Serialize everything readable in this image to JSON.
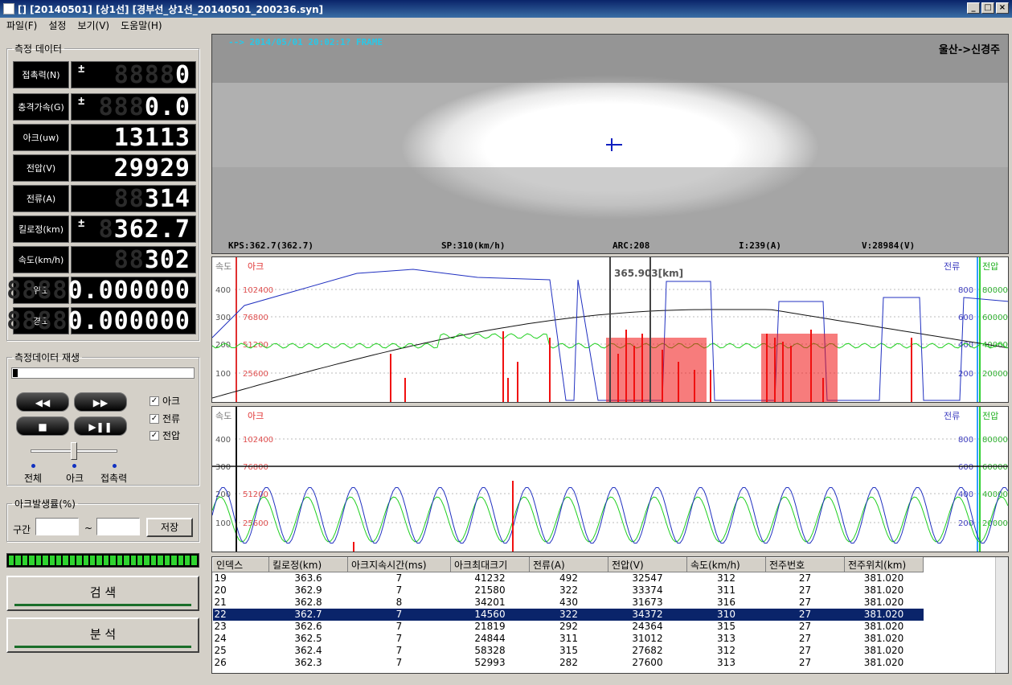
{
  "window": {
    "title": "[] [20140501] [상1선] [경부선_상1선_20140501_200236.syn]",
    "min": "_",
    "max": "□",
    "close": "×"
  },
  "menu": [
    "파일(F)",
    "설정",
    "보기(V)",
    "도움말(H)"
  ],
  "measure": {
    "legend": "측정 데이터",
    "rows": [
      {
        "label": "접촉력(N)",
        "ghost": "8888",
        "value": "0",
        "signed": true
      },
      {
        "label": "충격가속(G)",
        "ghost": "888",
        "value": "0.0",
        "signed": true
      },
      {
        "label": "아크(uw)",
        "ghost": "",
        "value": "13113",
        "signed": false
      },
      {
        "label": "전압(V)",
        "ghost": "",
        "value": "29929",
        "signed": false
      },
      {
        "label": "전류(A)",
        "ghost": "88",
        "value": "314",
        "signed": false
      },
      {
        "label": "킬로정(km)",
        "ghost": "8",
        "value": "362.7",
        "signed": true
      },
      {
        "label": "속도(km/h)",
        "ghost": "88",
        "value": "302",
        "signed": false
      },
      {
        "label": "위도",
        "ghost": "8888",
        "value": "0.000000",
        "signed": false
      },
      {
        "label": "경도",
        "ghost": "8888",
        "value": "0.000000",
        "signed": false
      }
    ]
  },
  "replay": {
    "legend": "측정데이터 재생",
    "progress": 0.02,
    "buttons": [
      "◀◀",
      "▶▶",
      "■",
      "▶❚❚"
    ],
    "checks": [
      {
        "label": "아크",
        "checked": true
      },
      {
        "label": "전류",
        "checked": true
      },
      {
        "label": "전압",
        "checked": true
      }
    ],
    "slider_labels": [
      "전체",
      "아크",
      "접촉력"
    ]
  },
  "arcrate": {
    "legend": "아크발생률(%)",
    "range_label": "구간",
    "tilde": "~",
    "save": "저장"
  },
  "buttons": {
    "search": "검 색",
    "analyze": "분 석"
  },
  "video": {
    "direction": "울산->신경주",
    "top_text": "-->  2014/05/01  20:02:1?  FRAME",
    "bottom": [
      {
        "text": "KPS:362.7(362.7)",
        "color": "#2a8bd0"
      },
      {
        "text": "SP:310(km/h)",
        "color": "#2a8bd0"
      },
      {
        "text": "ARC:208",
        "color": "#d02020"
      },
      {
        "text": "I:239(A)",
        "color": "#2020b0"
      },
      {
        "text": "V:28984(V)",
        "color": "#20a020"
      }
    ]
  },
  "chart_top": {
    "left_labels": [
      "속도",
      "아크"
    ],
    "right_labels": [
      "전류",
      "전압"
    ],
    "marker": "365.903[km]",
    "speed_ticks": [
      "400",
      "300",
      "200",
      "100"
    ],
    "arc_ticks": [
      "102400",
      "76800",
      "51200",
      "25600"
    ],
    "current_ticks": [
      "800",
      "600",
      "400",
      "200"
    ],
    "volt_ticks": [
      "80000",
      "60000",
      "40000",
      "20000"
    ]
  },
  "chart_bottom": {
    "left_labels": [
      "속도",
      "아크"
    ],
    "right_labels": [
      "전류",
      "전압"
    ],
    "speed_ticks": [
      "400",
      "300",
      "200",
      "100"
    ],
    "arc_ticks": [
      "102400",
      "76800",
      "51200",
      "25600"
    ],
    "current_ticks": [
      "800",
      "600",
      "400",
      "200"
    ],
    "volt_ticks": [
      "80000",
      "60000",
      "40000",
      "20000"
    ]
  },
  "table": {
    "headers": [
      "인덱스",
      "킬로정(km)",
      "아크지속시간(ms)",
      "아크최대크기",
      "전류(A)",
      "전압(V)",
      "속도(km/h)",
      "전주번호",
      "전주위치(km)"
    ],
    "rows": [
      [
        "19",
        "363.6",
        "7",
        "41232",
        "492",
        "32547",
        "312",
        "27",
        "381.020"
      ],
      [
        "20",
        "362.9",
        "7",
        "21580",
        "322",
        "33374",
        "311",
        "27",
        "381.020"
      ],
      [
        "21",
        "362.8",
        "8",
        "34201",
        "430",
        "31673",
        "316",
        "27",
        "381.020"
      ],
      [
        "22",
        "362.7",
        "7",
        "14560",
        "322",
        "34372",
        "310",
        "27",
        "381.020"
      ],
      [
        "23",
        "362.6",
        "7",
        "21819",
        "292",
        "24364",
        "315",
        "27",
        "381.020"
      ],
      [
        "24",
        "362.5",
        "7",
        "24844",
        "311",
        "31012",
        "313",
        "27",
        "381.020"
      ],
      [
        "25",
        "362.4",
        "7",
        "58328",
        "315",
        "27682",
        "312",
        "27",
        "381.020"
      ],
      [
        "26",
        "362.3",
        "7",
        "52993",
        "282",
        "27600",
        "313",
        "27",
        "381.020"
      ]
    ],
    "selected": 3
  }
}
